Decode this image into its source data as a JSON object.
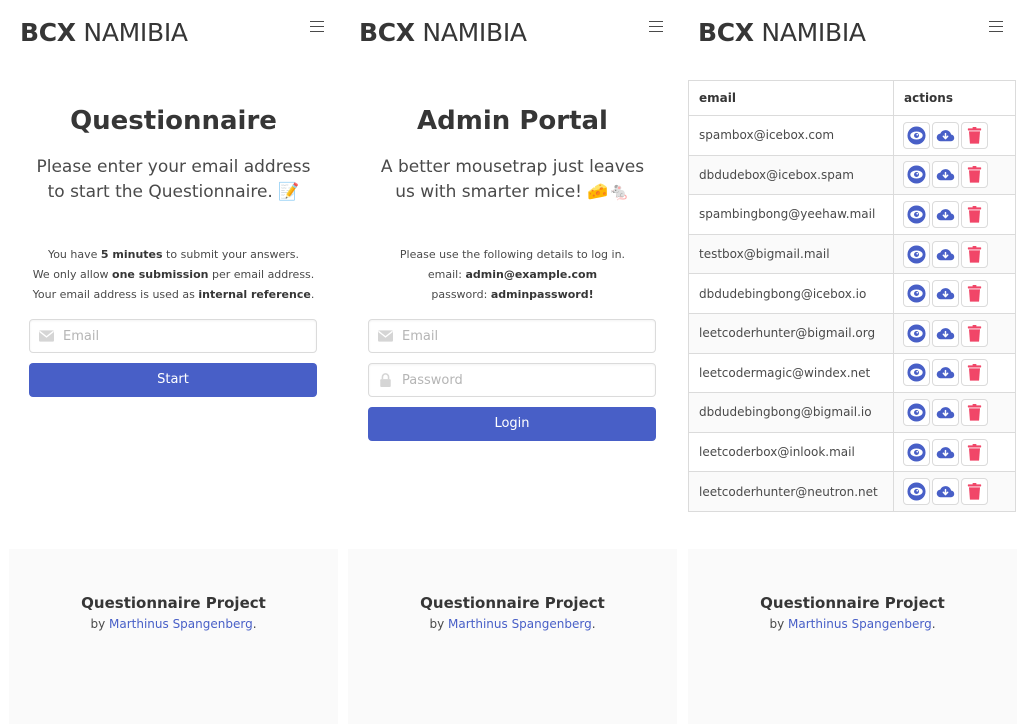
{
  "brand": {
    "bold": "BCX",
    "rest": " NAMIBIA"
  },
  "questionnaire": {
    "title": "Questionnaire",
    "subtitle_line1": "Please enter your email address",
    "subtitle_line2": "to start the Questionnaire. 📝",
    "info": {
      "l1_pre": "You have ",
      "l1_bold": "5 minutes",
      "l1_post": " to submit your answers.",
      "l2_pre": "We only allow ",
      "l2_bold": "one submission",
      "l2_post": " per email address.",
      "l3_pre": "Your email address is used as ",
      "l3_bold": "internal reference",
      "l3_post": "."
    },
    "email_placeholder": "Email",
    "start_label": "Start"
  },
  "admin": {
    "title": "Admin Portal",
    "subtitle_line1": "A better mousetrap just leaves",
    "subtitle_line2": "us with smarter mice! 🧀🐁",
    "info": {
      "l1": "Please use the following details to log in.",
      "l2_pre": "email: ",
      "l2_bold": "admin@example.com",
      "l3_pre": "password: ",
      "l3_bold": "adminpassword!"
    },
    "email_placeholder": "Email",
    "password_placeholder": "Password",
    "login_label": "Login"
  },
  "table": {
    "headers": {
      "email": "email",
      "actions": "actions"
    },
    "rows": [
      "spambox@icebox.com",
      "dbdudebox@icebox.spam",
      "spambingbong@yeehaw.mail",
      "testbox@bigmail.mail",
      "dbdudebingbong@icebox.io",
      "leetcoderhunter@bigmail.org",
      "leetcodermagic@windex.net",
      "dbdudebingbong@bigmail.io",
      "leetcoderbox@inlook.mail",
      "leetcoderhunter@neutron.net"
    ],
    "action_icons": [
      "eye-icon",
      "cloud-download-icon",
      "trash-icon"
    ]
  },
  "footer": {
    "project": "Questionnaire Project",
    "by": "by ",
    "author": "Marthinus Spangenberg",
    "dot": "."
  },
  "colors": {
    "primary": "#485fc7",
    "danger": "#f14668",
    "footer_bg": "#fafafa"
  }
}
